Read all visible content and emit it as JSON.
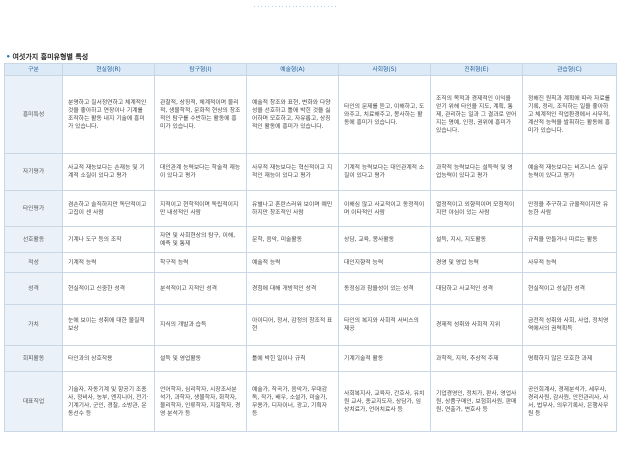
{
  "top_text": "· · · · · · · · · · · · · · · · · · · · · · · ·",
  "section_title": "여섯가지 흥미유형별 특성",
  "table": {
    "headers": [
      "구분",
      "현실형(R)",
      "탐구형(I)",
      "예술형(A)",
      "사회형(S)",
      "진취형(E)",
      "관습형(C)"
    ],
    "rows": [
      {
        "label": "흥미특성",
        "cells": [
          "분명하고 질서정연하고 체계적인 것을 좋아하고 연장이나 기계를 조작하는 활동 내지 기술에 흥미가 있습니다.",
          "관찰적, 상징적, 체계적이며 물리적, 생물학적, 문화적 현상의 창조적인 탐구를 수반하는 활동에 흥미가 있습니다.",
          "예술적 창조와 표현, 변화와 다양성을 선호하고 틀에 박힌 것을 싫어하며 모호하고, 자유롭고, 상징적인 활동에 흥미가 있습니다.",
          "타인의 문제를 듣고, 이해하고, 도와주고, 치료해주고, 봉사하는 활동에 흥미가 있습니다.",
          "조직의 목적과 경제적인 이익을 얻기 위해 타인을 지도, 계획, 통제, 관리하는 일과 그 결과로 얻어지는 명예, 인정, 권위에 흥미가 있습니다.",
          "정해진 원칙과 계획에 따라 자료를 기록, 정리, 조직하는 일을 좋아하고 체계적인 작업환경에서 사무적, 계산적 능력을 발휘하는 활동에 흥미가 있습니다."
        ]
      },
      {
        "label": "자기평가",
        "cells": [
          "사교적 재능보다는 손재능 및 기계적 소질이 있다고 평가",
          "대인관계 능력보다는 학술적 재능이 있다고 평가",
          "사무적 재능보다는 혁신적이고 지적인 재능이 있다고 평가",
          "기계적 능력보다는 대인관계적 소질이 있다고 평가",
          "과학적 능력보다는 설득력 및 영업능력이 있다고 평가",
          "예술적 재능보다는 비즈니스 실무능력이 있다고 평가"
        ]
      },
      {
        "label": "타인평가",
        "cells": [
          "겸손하고 솔직하지만 독단적이고 고집이 센 사람",
          "지적이고 현학적이며 독립적이지만 내성적인 사람",
          "유별나고 혼란스러워 보이며 예민하지만 창조적인 사람",
          "이해심 많고 사교적이고 동정적이며 이타적인 사람",
          "열정적이고 외향적이며 모험적이지만 야심이 있는 사람",
          "안정을 추구하고 규율적이지만 유능한 사람"
        ]
      },
      {
        "label": "선호활동",
        "cells": [
          "기계나 도구 등의 조작",
          "자연 및 사회현상의 탐구, 이해, 예측 및 통제",
          "문학, 음악, 미술활동",
          "상담, 교육, 봉사활동",
          "설득, 지시, 지도활동",
          "규칙을 만들거나 따르는 활동"
        ]
      },
      {
        "label": "적성",
        "cells": [
          "기계적 능력",
          "학구적 능력",
          "예술적 능력",
          "대인지향적 능력",
          "경영 및 영업 능력",
          "사무적 능력"
        ]
      },
      {
        "label": "성격",
        "cells": [
          "현실적이고 신중한 성격",
          "분석적이고 지적인 성격",
          "경험에 대해 개방적인 성격",
          "동정심과 참을성이 있는 성격",
          "대담하고 사교적인 성격",
          "현실적이고 성실한 성격"
        ]
      },
      {
        "label": "가치",
        "cells": [
          "눈에 보이는 성취에 대한 물질적 보상",
          "지식의 개발과 습득",
          "아이디어, 정서, 감정의 창조적 표현",
          "타인의 복지와 사회적 서비스의 제공",
          "경제적 성취와 사회적 지위",
          "금전적 성취와 사회, 사업, 정치영역에서의 권력획득"
        ]
      },
      {
        "label": "회피활동",
        "cells": [
          "타인과의 상호작용",
          "설득 및 영업활동",
          "틀에 박힌 일이나 규칙",
          "기계기술적 활동",
          "과학적, 지적, 추상적 주제",
          "명확하지 않은 모호한 과제"
        ]
      },
      {
        "label": "대표직업",
        "cells": [
          "기술자, 자동기계 및 항공기 조종사, 정비사, 농부, 엔지니어, 전기·기계기사, 군인, 경찰, 소방관, 운동선수 등",
          "언어학자, 심리학자, 시장조사분석가, 과학자, 생물학자, 화학자, 물리학자, 인류학자, 지질학자, 경영 분석가 등",
          "예술가, 작곡가, 음악가, 무대감독, 작가, 배우, 소설가, 미술가, 무용가, 디자이너, 광고, 기획자 등",
          "사회복지사, 교육자, 간호사, 유치원 교사, 종교지도자, 상담가, 임상치료가, 언어치료사 등",
          "기업경영인, 정치가, 판사, 영업사원, 상품구매인, 보험회사원, 판매원, 연출가, 변호사 등",
          "공인회계사, 경제분석가, 세무사, 경리사원, 감사원, 안전관리사, 사서, 법무사, 의무기록사, 은행사무원 등"
        ]
      }
    ]
  }
}
